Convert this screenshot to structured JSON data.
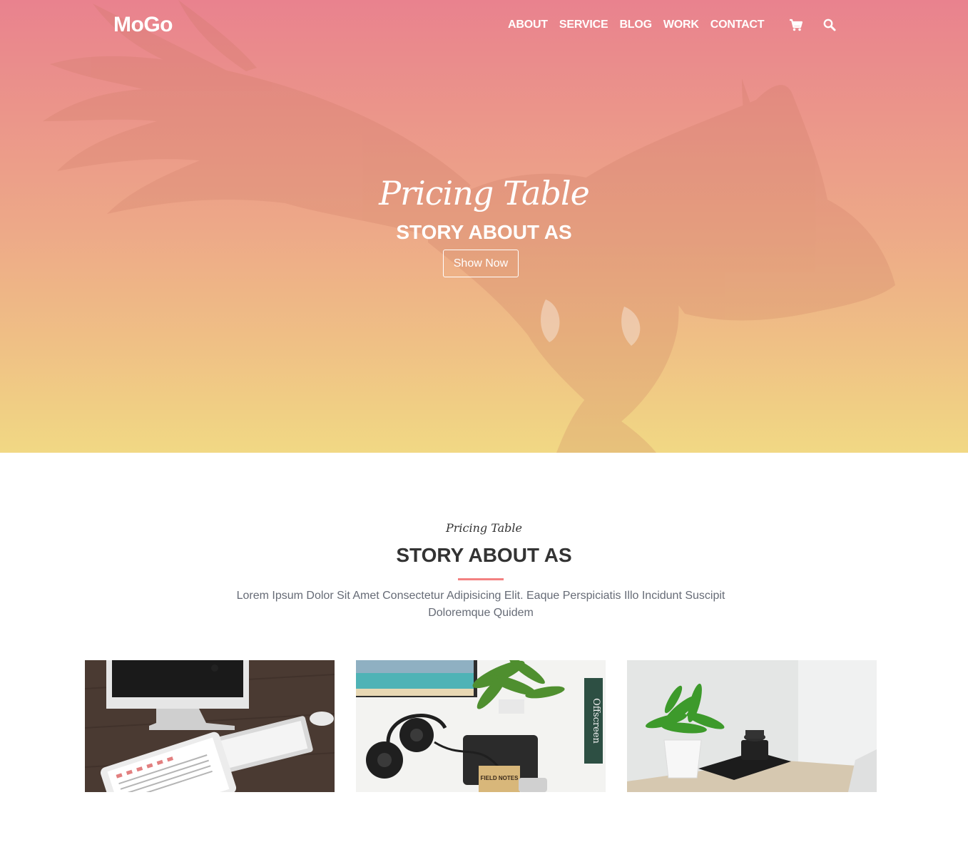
{
  "brand": {
    "logo": "MoGo"
  },
  "nav": {
    "links": [
      "ABOUT",
      "SERVICE",
      "BLOG",
      "WORK",
      "CONTACT"
    ],
    "icons": [
      "cart-icon",
      "search-icon"
    ]
  },
  "hero": {
    "script_title": "Pricing Table",
    "title": "STORY ABOUT AS",
    "button_label": "Show Now"
  },
  "section": {
    "script_title": "Pricing Table",
    "title": "STORY ABOUT AS",
    "text": "Lorem Ipsum Dolor Sit Amet Consectetur Adipisicing Elit. Eaque Perspiciatis Illo Incidunt Suscipit Doloremque Quidem"
  },
  "colors": {
    "accent": "#f38181",
    "hero_top": "#e9828e",
    "hero_bottom": "#f1d884"
  },
  "cards": [
    {
      "image": "desk-computer-keyboard-tablet"
    },
    {
      "image": "headphones-plant-notebook"
    },
    {
      "image": "plant-camera-table"
    }
  ],
  "card_text": {
    "notebook": "FIELD NOTES",
    "book_spine": "Offscreen"
  }
}
